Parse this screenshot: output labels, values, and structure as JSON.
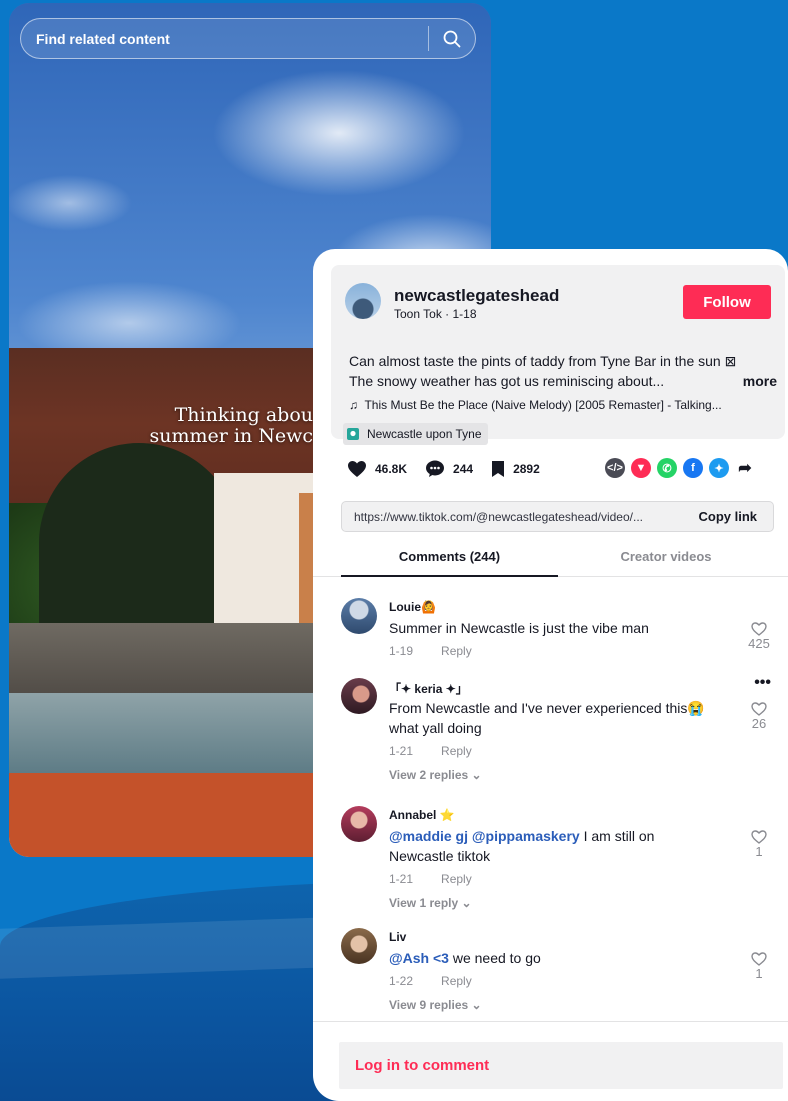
{
  "search": {
    "placeholder": "Find related content"
  },
  "video": {
    "caption_line1": "Thinking abou",
    "caption_line2": "summer in Newc"
  },
  "post": {
    "username": "newcastlegateshead",
    "subtitle": "Toon Tok · 1-18",
    "follow_label": "Follow",
    "description_line1": "Can almost taste the pints of taddy from Tyne Bar in the sun ⊠",
    "description_line2": "The snowy weather has got us reminiscing about...",
    "more_label": "more",
    "music": "This Must Be the Place (Naive Melody) [2005 Remaster] - Talking...",
    "location": "Newcastle upon Tyne"
  },
  "stats": {
    "likes": "46.8K",
    "comments": "244",
    "saves": "2892"
  },
  "share": {
    "url": "https://www.tiktok.com/@newcastlegateshead/video/...",
    "copy_label": "Copy link"
  },
  "tabs": {
    "comments": "Comments (244)",
    "creator": "Creator videos"
  },
  "comments": [
    {
      "name": "Louie🙆",
      "text": "Summer in Newcastle is just the vibe man",
      "date": "1-19",
      "reply": "Reply",
      "likes": "425"
    },
    {
      "name": "「✦ keria ✦」",
      "text": "From Newcastle and I've never experienced this😭 what yall doing",
      "date": "1-21",
      "reply": "Reply",
      "view": "View 2 replies ⌄",
      "likes": "26",
      "more": "•••"
    },
    {
      "name": "Annabel ⭐",
      "mention1": "@maddie gj",
      "mention2": "@pippamaskery",
      "text": " I am still on Newcastle tiktok",
      "date": "1-21",
      "reply": "Reply",
      "view": "View 1 reply ⌄",
      "likes": "1"
    },
    {
      "name": "Liv",
      "mention1": "@Ash <3",
      "text": " we need to go",
      "date": "1-22",
      "reply": "Reply",
      "view": "View 9 replies ⌄",
      "likes": "1"
    }
  ],
  "login": {
    "label": "Log in to comment"
  },
  "colors": {
    "accent": "#fe2c55",
    "mention": "#2b5db9",
    "background": "#0a78c8"
  }
}
